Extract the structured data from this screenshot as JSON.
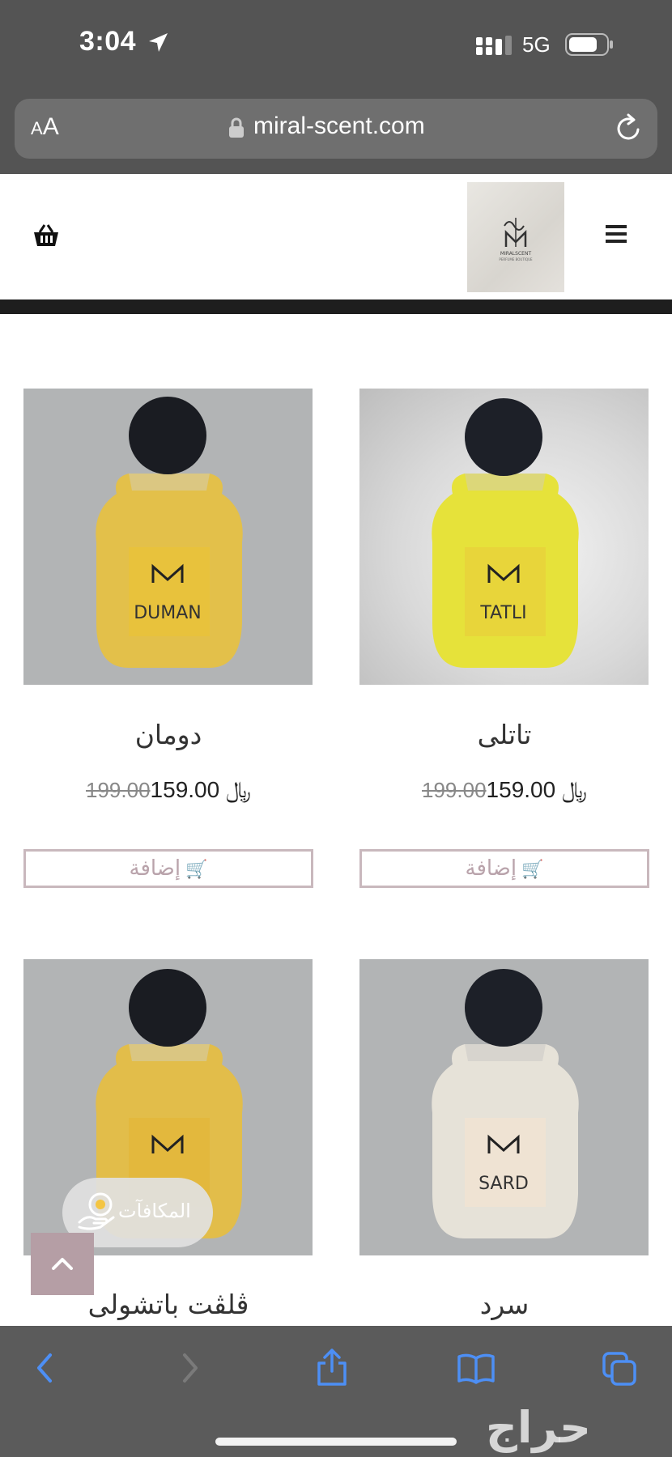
{
  "status_bar": {
    "time": "3:04",
    "network": "5G"
  },
  "browser": {
    "text_size_label_small": "A",
    "text_size_label_large": "A",
    "url": "miral-scent.com"
  },
  "site": {
    "brand_mark": "MIRALSCENT",
    "brand_tagline": "PERFUME BOUTIQUE"
  },
  "products": [
    {
      "name": "تاتلى",
      "label": "TATLI",
      "old_price": "199.00",
      "price": "159.00",
      "currency": "﷼",
      "add_label": "إضافة"
    },
    {
      "name": "دومان",
      "label": "DUMAN",
      "old_price": "199.00",
      "price": "159.00",
      "currency": "﷼",
      "add_label": "إضافة"
    },
    {
      "name": "سرد",
      "label": "SARD"
    },
    {
      "name": "ڤلڤت باتشولى",
      "label": ""
    }
  ],
  "rewards": {
    "label": "المكافآت"
  },
  "watermark": "حراج",
  "colors": {
    "chrome": "#545454",
    "accent": "#b59ea5",
    "button_border": "#c9b8bd",
    "image_bg": "#b2b4b5"
  }
}
